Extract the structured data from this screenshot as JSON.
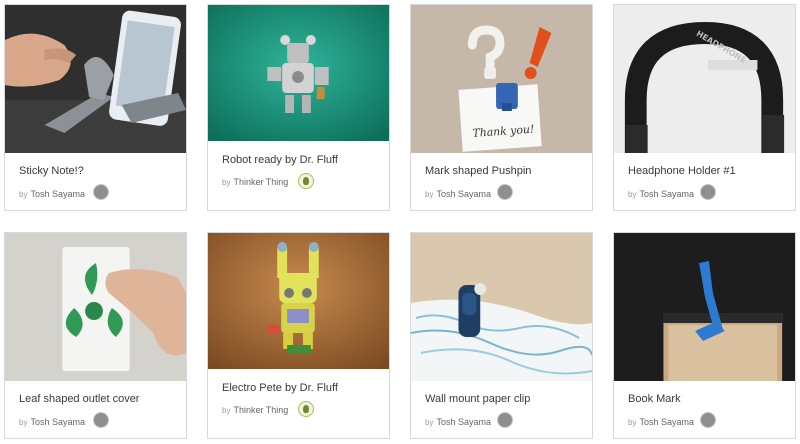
{
  "cards": [
    {
      "title": "Sticky Note!?",
      "by": "by",
      "author": "Tosh Sayama",
      "avatar": "person-avatar"
    },
    {
      "title": "Robot ready by Dr. Fluff",
      "by": "by",
      "author": "Thinker Thing",
      "avatar": "thinker-logo"
    },
    {
      "title": "Mark shaped Pushpin",
      "by": "by",
      "author": "Tosh Sayama",
      "avatar": "person-avatar"
    },
    {
      "title": "Headphone Holder #1",
      "by": "by",
      "author": "Tosh Sayama",
      "avatar": "person-avatar"
    },
    {
      "title": "Leaf shaped outlet cover",
      "by": "by",
      "author": "Tosh Sayama",
      "avatar": "person-avatar"
    },
    {
      "title": "Electro Pete by Dr. Fluff",
      "by": "by",
      "author": "Thinker Thing",
      "avatar": "thinker-logo"
    },
    {
      "title": "Wall mount paper clip",
      "by": "by",
      "author": "Tosh Sayama",
      "avatar": "person-avatar"
    },
    {
      "title": "Book Mark",
      "by": "by",
      "author": "Tosh Sayama",
      "avatar": "person-avatar"
    }
  ],
  "thumbnail_subjects": [
    "phone-stand-photo",
    "robot-figure-photo",
    "pushpin-photo",
    "headphone-holder-photo",
    "leaf-outlet-photo",
    "electro-pete-photo",
    "paper-clip-photo",
    "bookmark-photo"
  ],
  "handwritten_note": "Thank you!",
  "headphone_brand": "HEADPHONE"
}
